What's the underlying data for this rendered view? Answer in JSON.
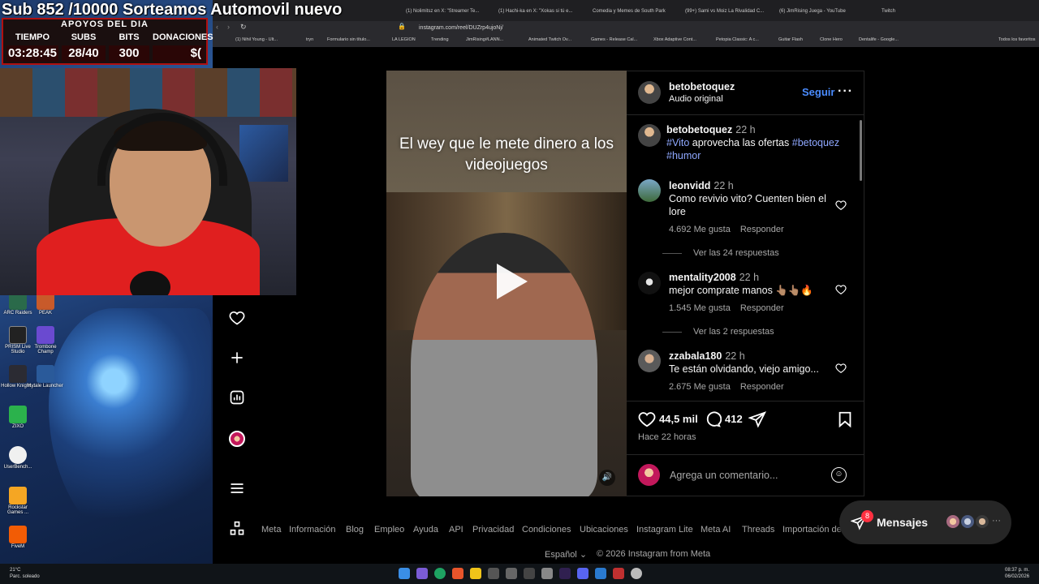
{
  "overlay": {
    "banner": "Sub 852 /10000 Sorteamos Automovil nuevo",
    "stats_heading": "APOYOS DEL DIA",
    "stats": [
      {
        "label": "TIEMPO",
        "value": "03:28:45"
      },
      {
        "label": "SUBS",
        "value": "28/40"
      },
      {
        "label": "BITS",
        "value": "300"
      },
      {
        "label": "DONACIONES",
        "value": "$("
      }
    ]
  },
  "desktop_icons": [
    {
      "label": "ARC Raiders",
      "color": "#2a6a4a"
    },
    {
      "label": "PEAK",
      "color": "#c85a2a"
    },
    {
      "label": "PRISM Live Studio",
      "color": "#222"
    },
    {
      "label": "Trombone Champ",
      "color": "#6a4ad0"
    },
    {
      "label": "Hollow Knight...",
      "color": "#2b2b33"
    },
    {
      "label": "Hytale Launcher",
      "color": "#2a5a9a"
    },
    {
      "label": "ZIXO",
      "color": "#2bb24c"
    },
    {
      "label": "UserBench...",
      "color": "#f0f0f0"
    },
    {
      "label": "Rockstar Games ...",
      "color": "#f5a623"
    },
    {
      "label": "FiveM",
      "color": "#f25c05"
    }
  ],
  "browser": {
    "tabs": [
      "(1) Nolimitsz en X: \"Streamer Te...",
      "(1) Hachi-ka en X: \"Xokas si tú e...",
      "Comedia y Memes de South Park",
      "(99+) Sami vs Moiz La Rivalidad C...",
      "(6) JimRising Juega - YouTube",
      "Twitch"
    ],
    "url": "instagram.com/reel/DUZrp4ujoNj/",
    "bookmarks": [
      "(1) Nihil Young - Ult...",
      "tryn",
      "Formulario sin título...",
      "LA LEGION",
      "Trending",
      "JimRising#LANN...",
      "Animated Twitch Ov...",
      "Games - Release Cal...",
      "Xbox Adaptive Cont...",
      "Petopia Classic: A c...",
      "Guitar Flash",
      "Clone Hero",
      "Dentalife - Google...",
      "Todos los favoritos"
    ]
  },
  "post": {
    "author": "betobetoquez",
    "audio": "Audio original",
    "follow_label": "Seguir",
    "video_caption": "El wey que le mete dinero a los videojuegos",
    "caption": {
      "user": "betobetoquez",
      "time": "22 h",
      "tag1": "#Vito",
      "text": "aprovecha las ofertas",
      "tag2": "#betoquez",
      "tag3": "#humor"
    },
    "comments": [
      {
        "user": "leonvidd",
        "time": "22 h",
        "text": "Como revivio vito? Cuenten bien el lore",
        "likes": "4.692 Me gusta",
        "reply": "Responder",
        "replies": "Ver las 24 respuestas"
      },
      {
        "user": "mentality2008",
        "time": "22 h",
        "text": "mejor comprate manos 👆🏽👆🏽🔥",
        "likes": "1.545 Me gusta",
        "reply": "Responder",
        "replies": "Ver las 2 respuestas"
      },
      {
        "user": "zzabala180",
        "time": "22 h",
        "text": "Te están olvidando, viejo amigo...",
        "likes": "2.675 Me gusta",
        "reply": "Responder",
        "replies": ""
      }
    ],
    "likes": "44,5 mil",
    "comments_count": "412",
    "time_ago": "Hace 22 horas",
    "comment_placeholder": "Agrega un comentario..."
  },
  "footer": {
    "links": [
      "Meta",
      "Información",
      "Blog",
      "Empleo",
      "Ayuda",
      "API",
      "Privacidad",
      "Condiciones",
      "Ubicaciones",
      "Instagram Lite",
      "Meta AI",
      "Threads",
      "Importación de"
    ],
    "language": "Español",
    "copyright": "© 2026 Instagram from Meta"
  },
  "messages": {
    "label": "Mensajes",
    "badge": "8"
  },
  "taskbar": {
    "temp": "21°C",
    "weather": "Parc. soleado",
    "time": "08:37 p. m.",
    "date": "06/02/2026"
  },
  "colors": {
    "accent": "#4a8cff",
    "badge": "#ff3040",
    "overlay_red": "#b01010"
  }
}
